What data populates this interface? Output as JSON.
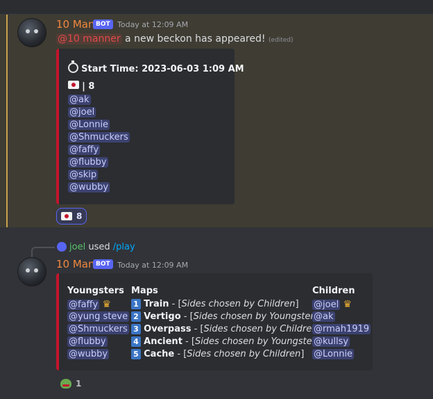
{
  "message1": {
    "username": "10 Man",
    "bot_badge": "BOT",
    "timestamp": "Today at 12:09 AM",
    "role_mention": "@10 manner",
    "text": " a new beckon has appeared!",
    "edited": "(edited)",
    "embed": {
      "start_label": "Start Time: ",
      "start_value": "2023-06-03  1:09 AM",
      "count_line": "| 8",
      "mentions": [
        "@ak",
        "@joel",
        "@Lonnie",
        "@Shmuckers",
        "@faffy",
        "@flubby",
        "@skip",
        "@wubby"
      ]
    },
    "reaction_count": "8"
  },
  "reply": {
    "user": "joel",
    "used_text": "used",
    "command": "/play"
  },
  "message2": {
    "username": "10 Man",
    "bot_badge": "BOT",
    "timestamp": "Today at 12:09 AM",
    "embed": {
      "youngsters_title": "Youngsters",
      "youngsters": [
        "@faffy",
        "@yung steve",
        "@Shmuckers",
        "@flubby",
        "@wubby"
      ],
      "maps_title": "Maps",
      "maps": [
        {
          "num": "1",
          "name": "Train",
          "sep": " - [",
          "side": "Sides chosen by Children",
          "end": "]"
        },
        {
          "num": "2",
          "name": "Vertigo",
          "sep": " - [",
          "side": "Sides chosen by Youngsters",
          "end": "]"
        },
        {
          "num": "3",
          "name": "Overpass",
          "sep": " - [",
          "side": "Sides chosen by Children",
          "end": "]"
        },
        {
          "num": "4",
          "name": "Ancient",
          "sep": " - [",
          "side": "Sides chosen by Youngsters",
          "end": "]"
        },
        {
          "num": "5",
          "name": "Cache",
          "sep": " - [",
          "side": "Sides chosen by Children",
          "end": "]"
        }
      ],
      "children_title": "Children",
      "children": [
        "@joel",
        "@ak",
        "@rmah1919",
        "@kullsy",
        "@Lonnie"
      ]
    },
    "reaction_count": "1"
  },
  "colors": {
    "embed_accent": "#c4142c",
    "username": "#f0883e",
    "highlight_bg": "#3f3c33",
    "mention_bg": "#3c4270"
  },
  "icons": [
    "stopwatch-icon",
    "flag-icon",
    "crown-icon",
    "frog-icon",
    "discord-icon"
  ]
}
